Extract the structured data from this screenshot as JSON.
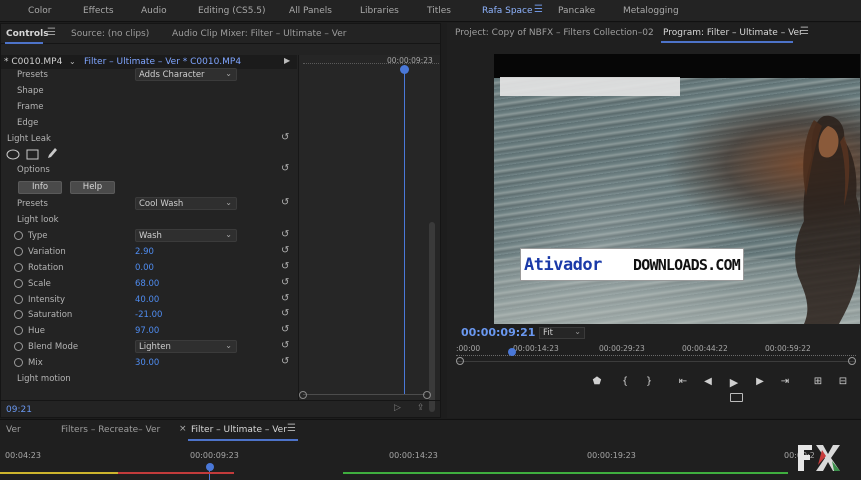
{
  "workspaces": {
    "items": [
      "Color",
      "Effects",
      "Audio",
      "Editing (CS5.5)",
      "All Panels",
      "Libraries",
      "Titles",
      "Rafa Space",
      "Pancake",
      "Metalogging"
    ],
    "active": "Rafa Space"
  },
  "left_panel": {
    "tabs": [
      "Controls",
      "Source: (no clips)",
      "Audio Clip Mixer: Filter – Ultimate – Ver"
    ],
    "active_tab": "Controls",
    "clip_selector": "* C0010.MP4",
    "clip_path": "Filter – Ultimate – Ver  * C0010.MP4",
    "mini_timecode": "00:00:09:23",
    "footer_timecode": "09:21"
  },
  "effect_controls": {
    "presets_top_label": "Presets",
    "presets_top_value": "Adds Character",
    "shape_label": "Shape",
    "frame_label": "Frame",
    "edge_label": "Edge",
    "light_leak_label": "Light Leak",
    "options_label": "Options",
    "info_button": "Info",
    "help_button": "Help",
    "presets_label": "Presets",
    "presets_value": "Cool Wash",
    "light_look_label": "Light look",
    "params": [
      {
        "label": "Type",
        "kind": "dropdown",
        "value": "Wash"
      },
      {
        "label": "Variation",
        "kind": "number",
        "value": "2.90"
      },
      {
        "label": "Rotation",
        "kind": "number",
        "value": "0.00"
      },
      {
        "label": "Scale",
        "kind": "number",
        "value": "68.00"
      },
      {
        "label": "Intensity",
        "kind": "number",
        "value": "40.00"
      },
      {
        "label": "Saturation",
        "kind": "number",
        "value": "-21.00"
      },
      {
        "label": "Hue",
        "kind": "number",
        "value": "97.00"
      },
      {
        "label": "Blend Mode",
        "kind": "dropdown",
        "value": "Lighten"
      },
      {
        "label": "Mix",
        "kind": "number",
        "value": "30.00"
      }
    ],
    "light_motion_label": "Light motion"
  },
  "program_monitor": {
    "tabs": [
      "Project: Copy of NBFX – Filters Collection–02",
      "Program: Filter – Ultimate – Ver"
    ],
    "active_tab": "Program: Filter – Ultimate – Ver",
    "timecode": "00:00:09:21",
    "zoom": "Fit",
    "ruler_labels": [
      ":00:00",
      "00:00:14:23",
      "00:00:29:23",
      "00:00:44:22",
      "00:00:59:22"
    ],
    "playhead_fraction": 0.14,
    "watermark_part1": "Ativador",
    "watermark_part2": "DOWNLOADS.COM"
  },
  "transport": {
    "icons": [
      "marker-icon",
      "mark-in-icon",
      "mark-out-icon",
      "go-to-in-icon",
      "step-back-icon",
      "play-icon",
      "step-forward-icon",
      "go-to-out-icon",
      "insert-icon",
      "overwrite-icon"
    ]
  },
  "timeline": {
    "tabs": [
      "Ver",
      "Filters – Recreate– Ver",
      "Filter – Ultimate – Ver"
    ],
    "active_tab": "Filter – Ultimate – Ver",
    "ruler_labels": [
      "00:04:23",
      "00:00:09:23",
      "00:00:14:23",
      "00:00:19:23",
      "00:00:2"
    ],
    "colors": {
      "red_bar": "#c23b3b",
      "green_bar": "#3fae3f",
      "yellow_bar": "#cdb42d"
    }
  },
  "accent_color": "#4d73c9"
}
